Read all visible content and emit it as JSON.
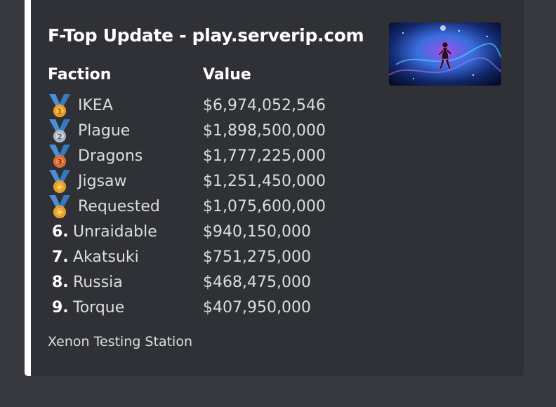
{
  "embed": {
    "title": "F-Top Update - play.serverip.com",
    "border_color": "#ffffff",
    "columns": {
      "faction": "Faction",
      "value": "Value"
    },
    "rows": [
      {
        "medal": "first-place-medal-icon",
        "rank": "",
        "faction": "IKEA",
        "value": "$6,974,052,546"
      },
      {
        "medal": "second-place-medal-icon",
        "rank": "",
        "faction": "Plague",
        "value": "$1,898,500,000"
      },
      {
        "medal": "third-place-medal-icon",
        "rank": "",
        "faction": "Dragons",
        "value": "$1,777,225,000"
      },
      {
        "medal": "sports-medal-icon",
        "rank": "",
        "faction": "Jigsaw",
        "value": "$1,251,450,000"
      },
      {
        "medal": "sports-medal-icon",
        "rank": "",
        "faction": "Requested",
        "value": "$1,075,600,000"
      },
      {
        "medal": "",
        "rank": "6.",
        "faction": "Unraidable",
        "value": "$940,150,000"
      },
      {
        "medal": "",
        "rank": "7.",
        "faction": "Akatsuki",
        "value": "$751,275,000"
      },
      {
        "medal": "",
        "rank": "8.",
        "faction": "Russia",
        "value": "$468,475,000"
      },
      {
        "medal": "",
        "rank": "9.",
        "faction": "Torque",
        "value": "$407,950,000"
      }
    ],
    "footer": "Xenon Testing Station",
    "thumbnail": "space-figure-thumbnail"
  },
  "colors": {
    "background": "#37393f",
    "embed_bg": "#2f3136",
    "title": "#ffffff",
    "text": "#dcddde",
    "ribbon": "#4a8fd6",
    "gold": "#f4a629",
    "silver": "#c9ced6",
    "bronze": "#e8743b"
  }
}
